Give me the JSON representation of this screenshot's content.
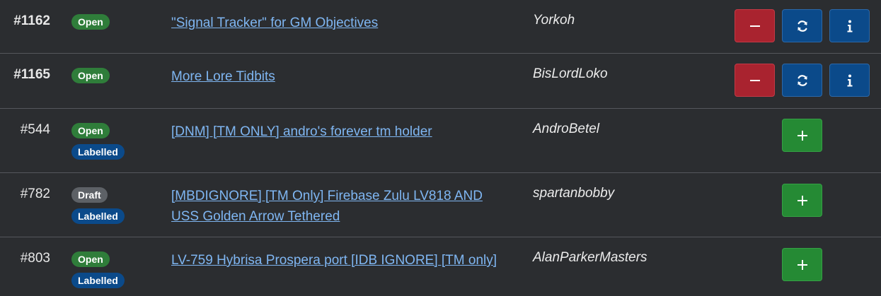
{
  "rows": [
    {
      "number": "#1162",
      "badges": [
        "Open"
      ],
      "title": "\"Signal Tracker\" for GM Objectives",
      "author": "Yorkoh",
      "actions": [
        "remove",
        "refresh",
        "info"
      ]
    },
    {
      "number": "#1165",
      "badges": [
        "Open"
      ],
      "title": "More Lore Tidbits",
      "author": "BisLordLoko",
      "actions": [
        "remove",
        "refresh",
        "info"
      ]
    },
    {
      "number": "#544",
      "badges": [
        "Open",
        "Labelled"
      ],
      "title": "[DNM] [TM ONLY] andro's forever tm holder",
      "author": "AndroBetel",
      "actions": [
        "add"
      ]
    },
    {
      "number": "#782",
      "badges": [
        "Draft",
        "Labelled"
      ],
      "title": "[MBDIGNORE] [TM Only] Firebase Zulu LV818 AND USS Golden Arrow Tethered",
      "author": "spartanbobby",
      "actions": [
        "add"
      ]
    },
    {
      "number": "#803",
      "badges": [
        "Open",
        "Labelled"
      ],
      "title": "LV-759 Hybrisa Prospera port [IDB IGNORE] [TM only]",
      "author": "AlanParkerMasters",
      "actions": [
        "add"
      ]
    }
  ],
  "icons": {
    "remove": "minus-icon",
    "refresh": "refresh-icon",
    "info": "info-icon",
    "add": "plus-icon"
  },
  "colors": {
    "background": "#2b2d30",
    "open_badge": "#2f7d3a",
    "draft_badge": "#5d6166",
    "labelled_badge": "#0b4a8a",
    "link": "#7fb6f2",
    "remove_button": "#a9232f",
    "blue_button": "#0b4a8a",
    "add_button": "#258a34"
  }
}
